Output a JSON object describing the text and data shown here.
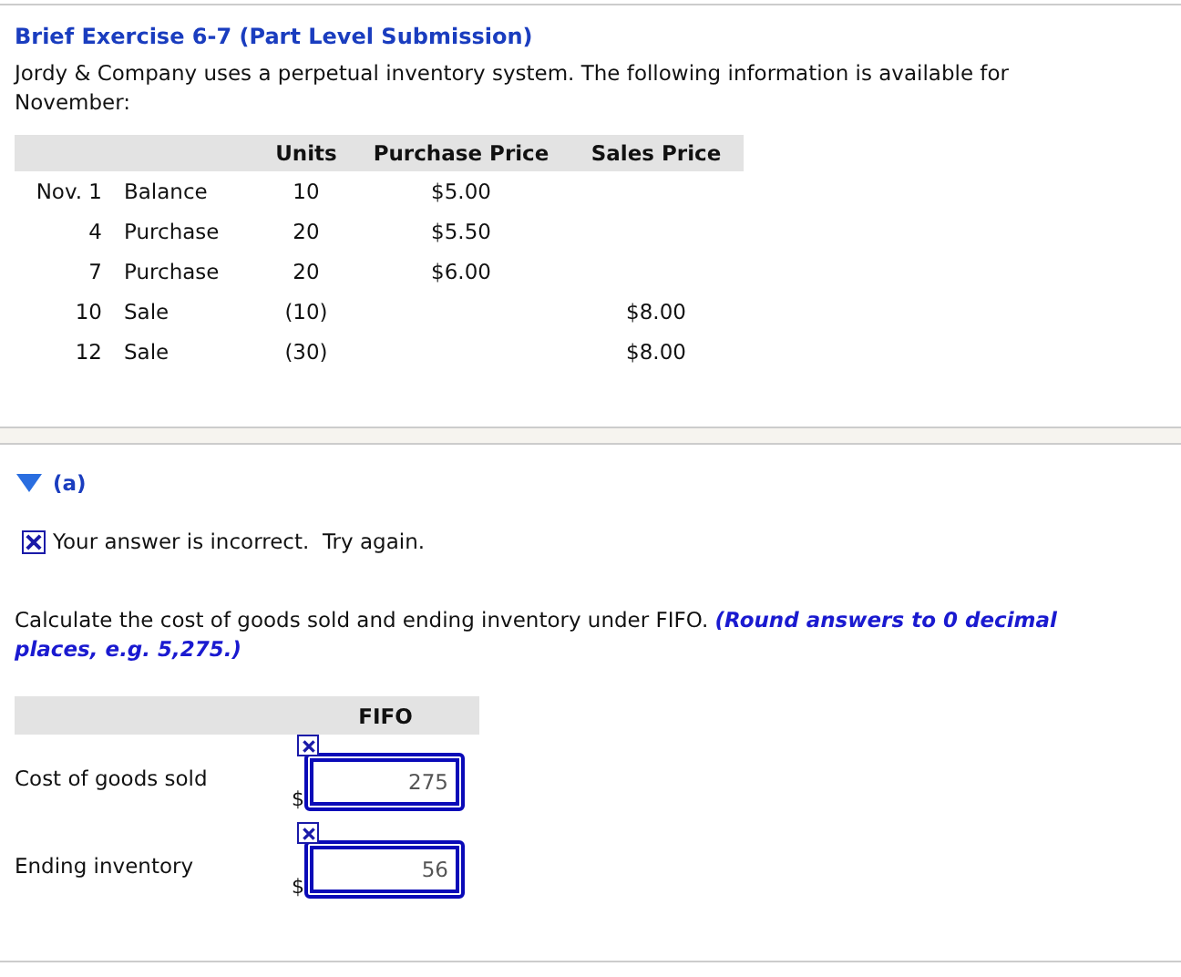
{
  "title": "Brief Exercise 6-7 (Part Level Submission)",
  "intro": "Jordy & Company uses a perpetual inventory system. The following information is available for November:",
  "inventory_table": {
    "columns": [
      "Units",
      "Purchase Price",
      "Sales Price"
    ],
    "rows": [
      {
        "date": "Nov. 1",
        "description": "Balance",
        "units": "10",
        "purchase_price": "$5.00"
      },
      {
        "date": "4",
        "description": "Purchase",
        "units": "20",
        "purchase_price": "$5.50"
      },
      {
        "date": "7",
        "description": "Purchase",
        "units": "20",
        "purchase_price": "$6.00"
      },
      {
        "date": "10",
        "description": "Sale",
        "units": "(10)",
        "sales_price": "$8.00"
      },
      {
        "date": "12",
        "description": "Sale",
        "units": "(30)",
        "sales_price": "$8.00"
      }
    ]
  },
  "part": {
    "label": "(a)",
    "expanded": true
  },
  "feedback": {
    "incorrect": true,
    "text": "Your answer is incorrect.  Try again."
  },
  "question": {
    "text": "Calculate the cost of goods sold and ending inventory under FIFO.",
    "note": "(Round answers to 0 decimal places, e.g. 5,275.)"
  },
  "answer_table": {
    "column": "FIFO",
    "rows": [
      {
        "label": "Cost of goods sold",
        "prefix": "$",
        "value": "275",
        "incorrect": true
      },
      {
        "label": "Ending inventory",
        "prefix": "$",
        "value": "56",
        "incorrect": true
      }
    ]
  }
}
